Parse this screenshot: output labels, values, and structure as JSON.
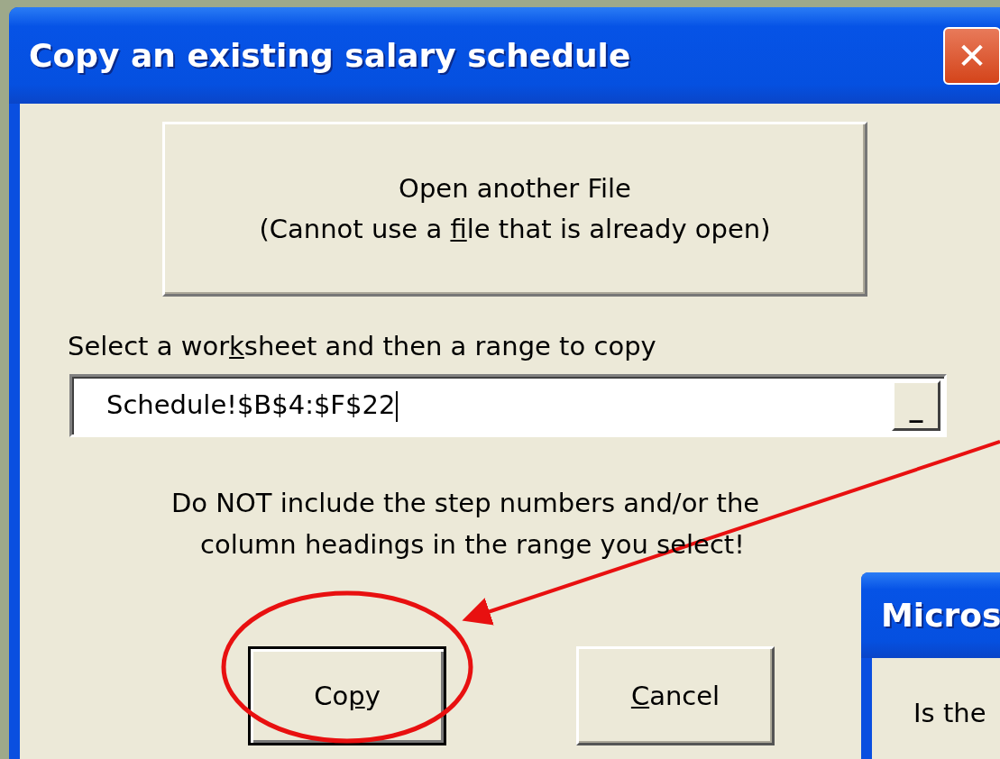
{
  "window": {
    "title": "Copy an existing salary schedule",
    "close_symbol": "✕"
  },
  "open_button": {
    "lines": [
      "Open another File",
      {
        "before": "(Cannot use a ",
        "key": "f",
        "after": "ile that is already open)"
      }
    ]
  },
  "range_label": {
    "before": "Select a wor",
    "key": "k",
    "after": "sheet and then a range to copy"
  },
  "range_field": {
    "value": "Schedule!$B$4:$F$22",
    "button_symbol": "_"
  },
  "note": [
    "Do NOT include the step numbers and/or the",
    "column headings in the range you select!"
  ],
  "buttons": [
    {
      "before": "Co",
      "key": "p",
      "after": "y",
      "default": true
    },
    {
      "key": "C",
      "after": "ancel",
      "default": false
    }
  ],
  "second_dialog": {
    "title": "Micros",
    "message": "Is the"
  },
  "annotations": {
    "copy_button_circled": true,
    "arrow_to_copy_button": true
  }
}
